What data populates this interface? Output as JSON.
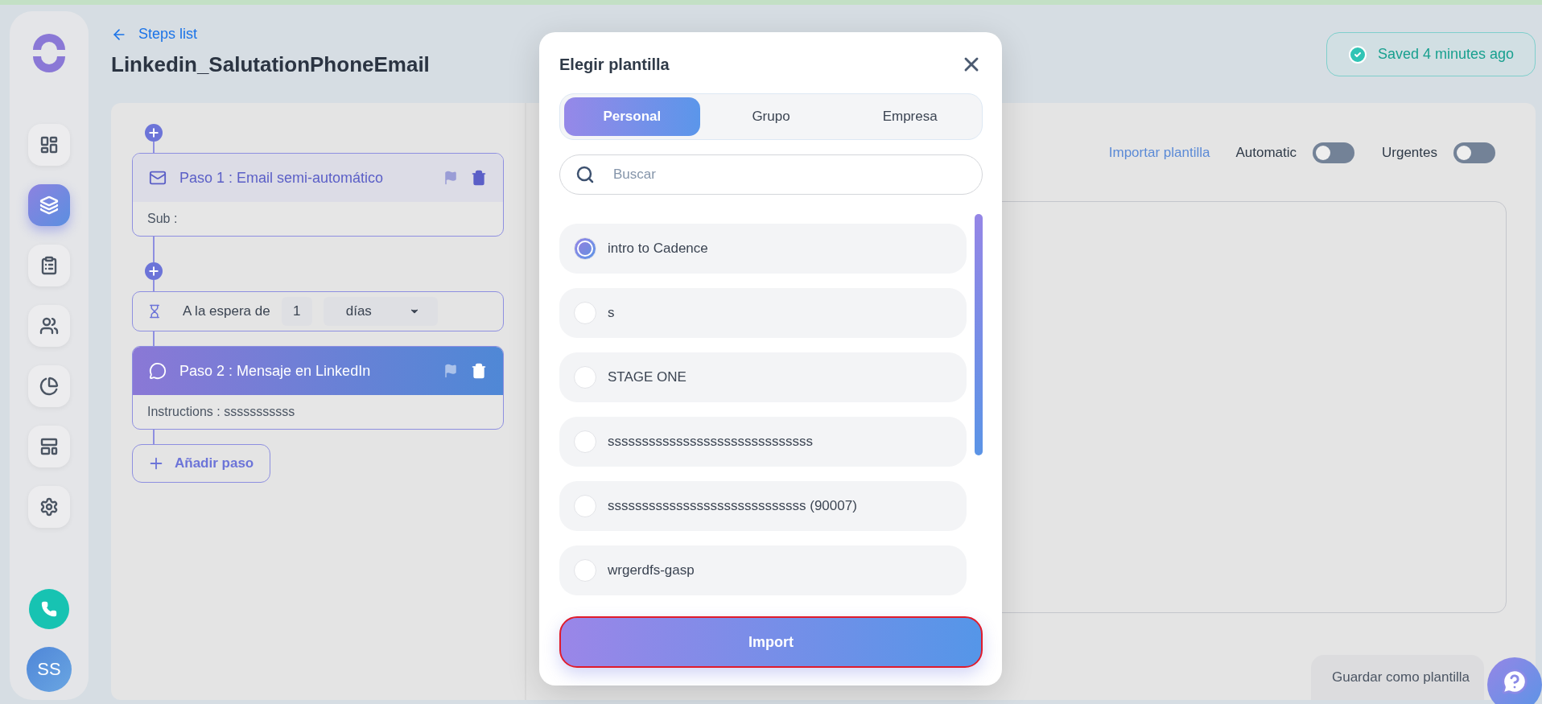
{
  "header": {
    "back_link": "Steps list",
    "title": "Linkedin_SalutationPhoneEmail"
  },
  "save_status": "Saved 4 minutes ago",
  "sidebar": {
    "items": [
      {
        "kind": "dashboard",
        "selected": false
      },
      {
        "kind": "cadence",
        "selected": true
      },
      {
        "kind": "tasks",
        "selected": false
      },
      {
        "kind": "people",
        "selected": false
      },
      {
        "kind": "reports",
        "selected": false
      },
      {
        "kind": "templates",
        "selected": false
      },
      {
        "kind": "settings",
        "selected": false
      }
    ],
    "avatar": "SS"
  },
  "steps": [
    {
      "kind": "email",
      "title": "Paso 1 : Email semi-automático",
      "body": "Sub :",
      "active": false,
      "add_before": true
    },
    {
      "kind": "wait",
      "label": "A la espera de",
      "amount": "1",
      "unit": "días",
      "add_before": true
    },
    {
      "kind": "linkedin",
      "title": "Paso 2 : Mensaje en LinkedIn",
      "body": "Instructions : sssssssssss",
      "active": true,
      "add_before": false
    }
  ],
  "add_step": "Añadir paso",
  "editor": {
    "import_link": "Importar plantilla",
    "toggles": [
      {
        "label": "Automatic",
        "on": false
      },
      {
        "label": "Urgentes",
        "on": false
      }
    ]
  },
  "save_template": "Guardar como plantilla",
  "modal": {
    "title": "Elegir plantilla",
    "tabs": [
      {
        "label": "Personal",
        "selected": true
      },
      {
        "label": "Grupo",
        "selected": false
      },
      {
        "label": "Empresa",
        "selected": false
      }
    ],
    "search": {
      "placeholder": "Buscar"
    },
    "templates": [
      {
        "name": "intro to Cadence",
        "selected": true
      },
      {
        "name": "s",
        "selected": false
      },
      {
        "name": "STAGE ONE",
        "selected": false
      },
      {
        "name": "ssssssssssssssssssssssssssssss",
        "selected": false
      },
      {
        "name": "sssssssssssssssssssssssssssss (90007)",
        "selected": false
      },
      {
        "name": "wrgerdfs-gasp",
        "selected": false
      }
    ],
    "import_button": "Import"
  }
}
